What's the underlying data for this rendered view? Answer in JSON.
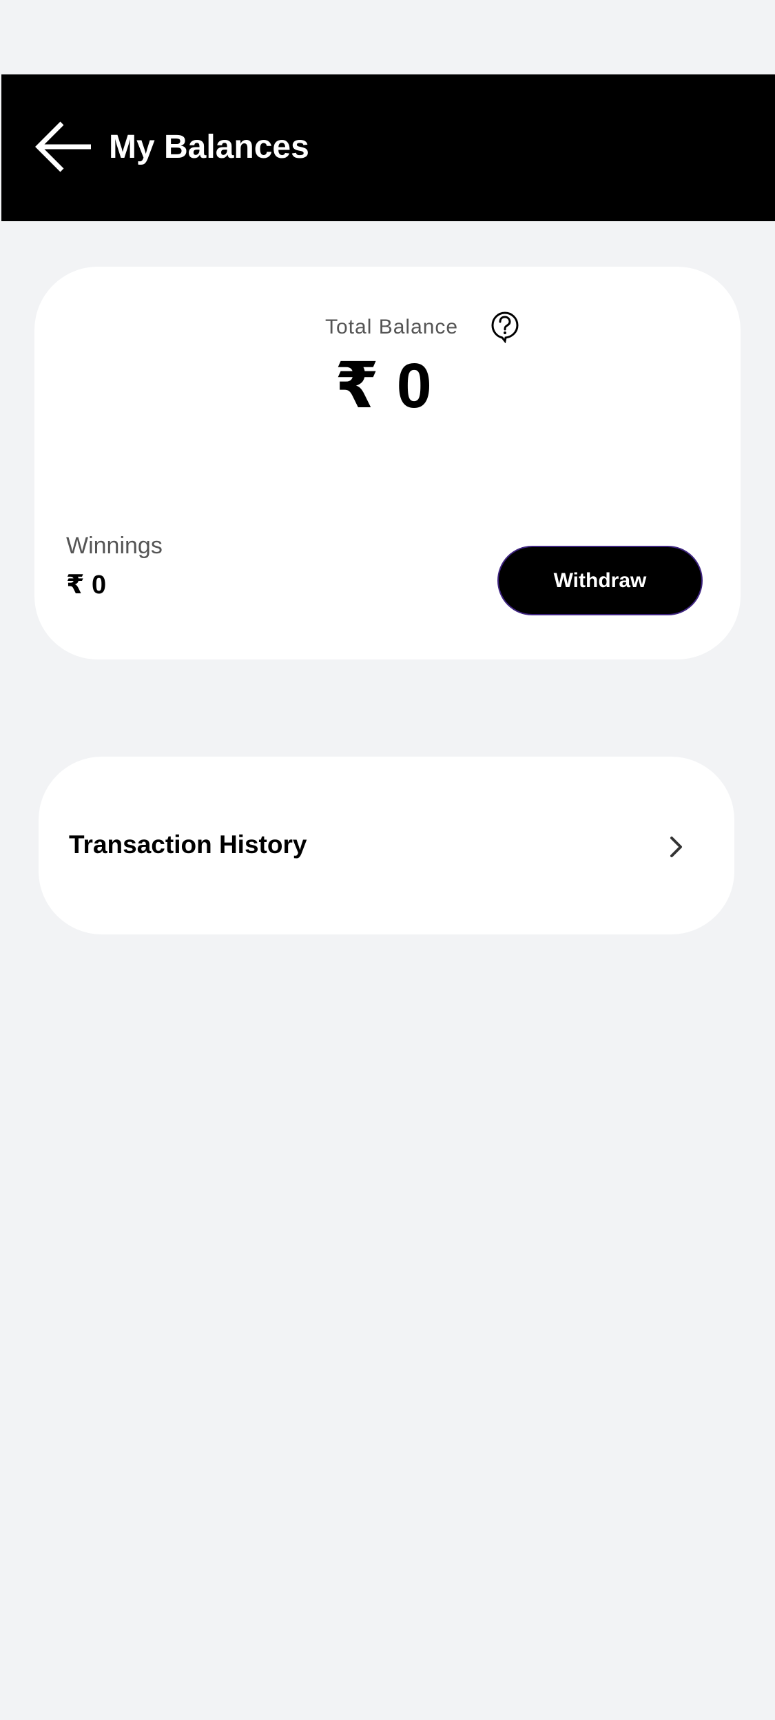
{
  "header": {
    "title": "My Balances",
    "back_icon": "arrow-left-icon",
    "background": "#000000",
    "text_color": "#ffffff"
  },
  "balance_card": {
    "total_label": "Total Balance",
    "total_amount": "₹ 0",
    "help_icon": "question-circle-icon",
    "winnings_label": "Winnings",
    "winnings_amount": "₹ 0",
    "withdraw_label": "Withdraw",
    "withdraw_border_color": "#3f2580"
  },
  "transaction_history": {
    "label": "Transaction History",
    "chevron_icon": "chevron-right-icon"
  },
  "colors": {
    "page_background": "#f2f3f5",
    "card_background": "#ffffff",
    "muted_text": "#555555"
  }
}
